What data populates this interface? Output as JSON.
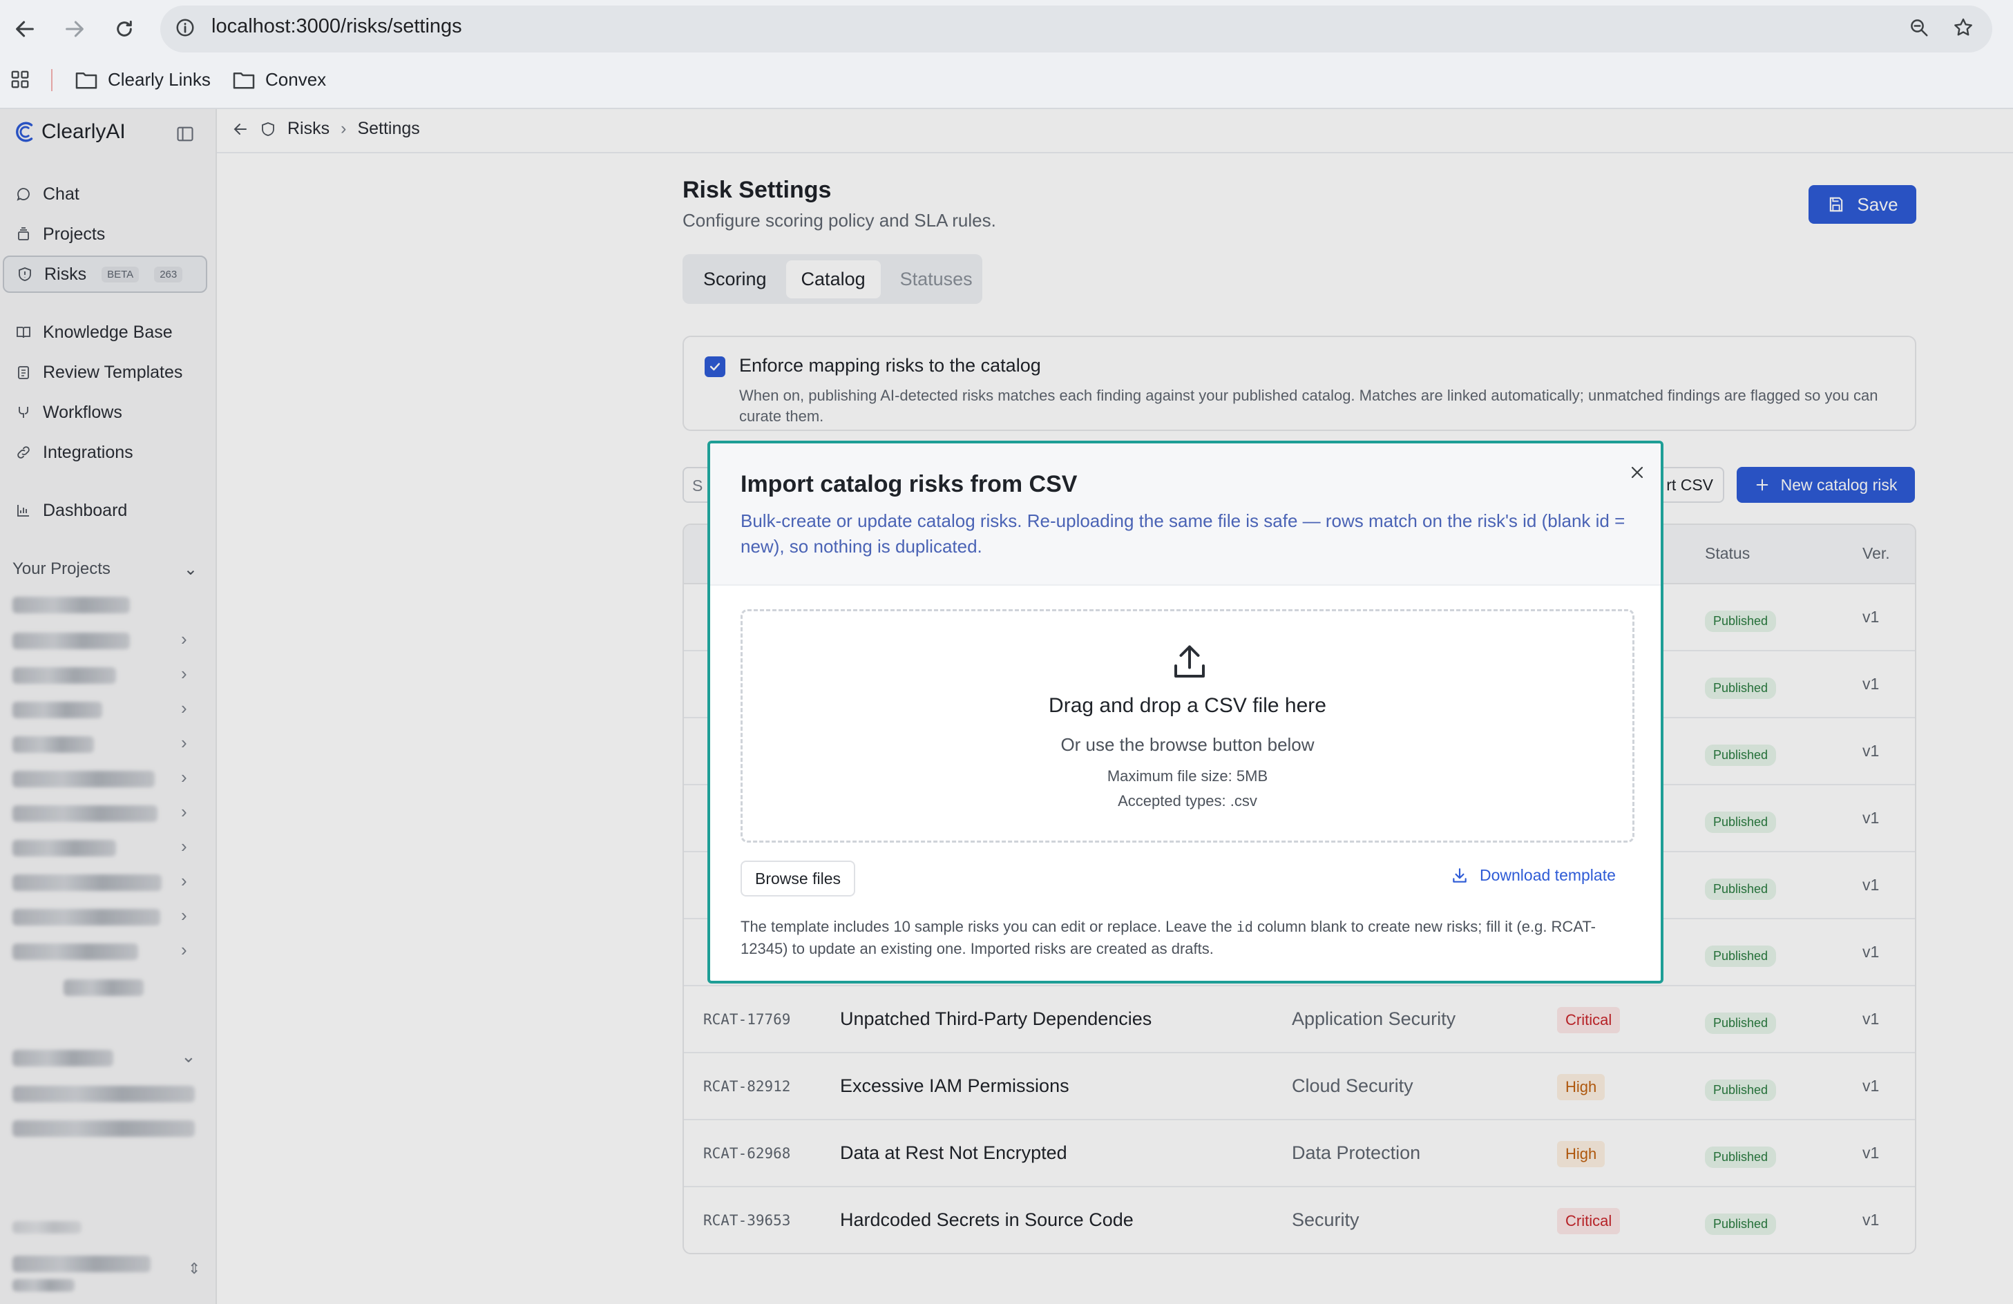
{
  "browser": {
    "url": "localhost:3000/risks/settings",
    "bookmarks": [
      "Clearly Links",
      "Convex"
    ]
  },
  "sidebar": {
    "logo": "ClearlyAI",
    "items": [
      {
        "label": "Chat",
        "icon": "chat-icon"
      },
      {
        "label": "Projects",
        "icon": "projects-icon"
      },
      {
        "label": "Risks",
        "icon": "shield-icon",
        "badge": "BETA",
        "count": "263"
      },
      {
        "label": "Knowledge Base",
        "icon": "book-icon"
      },
      {
        "label": "Review Templates",
        "icon": "clipboard-icon"
      },
      {
        "label": "Workflows",
        "icon": "workflow-icon"
      },
      {
        "label": "Integrations",
        "icon": "link-icon"
      },
      {
        "label": "Dashboard",
        "icon": "bar-chart-icon"
      }
    ],
    "your_projects_label": "Your Projects"
  },
  "breadcrumb": {
    "items": [
      "Risks",
      "Settings"
    ]
  },
  "page": {
    "title": "Risk Settings",
    "subtitle": "Configure scoring policy and SLA rules.",
    "save_label": "Save",
    "tabs": [
      "Scoring",
      "Catalog",
      "Statuses"
    ],
    "active_tab": "Catalog"
  },
  "enforce": {
    "checked": true,
    "title": "Enforce mapping risks to the catalog",
    "description": "When on, publishing AI-detected risks matches each finding against your published catalog. Matches are linked automatically; unmatched findings are flagged so you can curate them."
  },
  "toolbar": {
    "search_partial": "S",
    "import_partial": "rt CSV",
    "new_label": "New catalog risk"
  },
  "table": {
    "headers": {
      "status": "Status",
      "version": "Ver."
    },
    "hidden_rows": [
      {
        "status": "Published",
        "version": "v1"
      },
      {
        "status": "Published",
        "version": "v1"
      },
      {
        "status": "Published",
        "version": "v1"
      },
      {
        "status": "Published",
        "version": "v1"
      },
      {
        "status": "Published",
        "version": "v1"
      },
      {
        "status": "Published",
        "version": "v1"
      }
    ],
    "rows": [
      {
        "id": "RCAT-17769",
        "title": "Unpatched Third-Party Dependencies",
        "category": "Application Security",
        "severity": "Critical",
        "status": "Published",
        "version": "v1"
      },
      {
        "id": "RCAT-82912",
        "title": "Excessive IAM Permissions",
        "category": "Cloud Security",
        "severity": "High",
        "status": "Published",
        "version": "v1"
      },
      {
        "id": "RCAT-62968",
        "title": "Data at Rest Not Encrypted",
        "category": "Data Protection",
        "severity": "High",
        "status": "Published",
        "version": "v1"
      },
      {
        "id": "RCAT-39653",
        "title": "Hardcoded Secrets in Source Code",
        "category": "Security",
        "severity": "Critical",
        "status": "Published",
        "version": "v1"
      }
    ]
  },
  "modal": {
    "title": "Import catalog risks from CSV",
    "description": "Bulk-create or update catalog risks. Re-uploading the same file is safe — rows match on the risk's id (blank id = new), so nothing is duplicated.",
    "drop_title": "Drag and drop a CSV file here",
    "drop_sub": "Or use the browse button below",
    "max_size": "Maximum file size: 5MB",
    "accepted": "Accepted types: .csv",
    "browse_label": "Browse files",
    "download_label": "Download template",
    "note_before": "The template includes 10 sample risks you can edit or replace. Leave the ",
    "note_code": "id",
    "note_after": " column blank to create new risks; fill it (e.g. RCAT-12345) to update an existing one. Imported risks are created as drafts."
  },
  "colors": {
    "accent": "#2e5bd6",
    "modal_border": "#1e9e96",
    "critical": "#c8262b",
    "high": "#c0600f",
    "published": "#287a3e"
  }
}
